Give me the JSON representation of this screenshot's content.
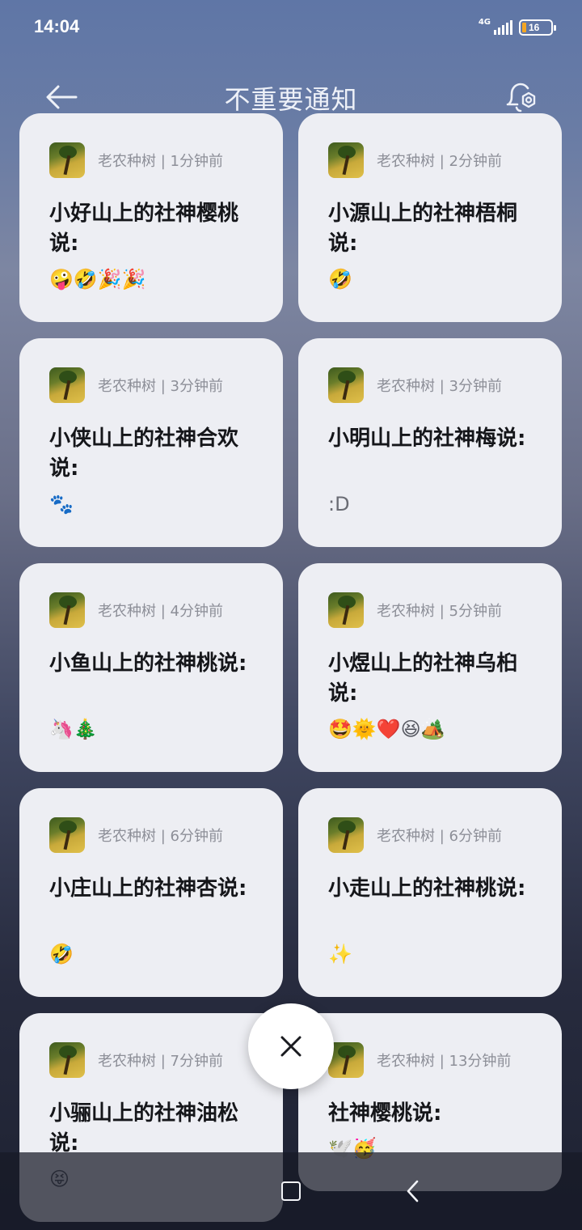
{
  "status_bar": {
    "time": "14:04",
    "network": "4G",
    "battery": "16"
  },
  "header": {
    "title": "不重要通知"
  },
  "notifications": [
    {
      "meta": "老农种树 | 1分钟前",
      "title": "小好山上的社神樱桃说:",
      "body": "🤪🤣🎉🎉"
    },
    {
      "meta": "老农种树 | 2分钟前",
      "title": "小源山上的社神梧桐说:",
      "body": "🤣"
    },
    {
      "meta": "老农种树 | 3分钟前",
      "title": "小侠山上的社神合欢说:",
      "body": "🐾"
    },
    {
      "meta": "老农种树 | 3分钟前",
      "title": "小明山上的社神梅说:",
      "body": ":D"
    },
    {
      "meta": "老农种树 | 4分钟前",
      "title": "小鱼山上的社神桃说:",
      "body": "🦄🎄"
    },
    {
      "meta": "老农种树 | 5分钟前",
      "title": "小煜山上的社神乌桕说:",
      "body": "🤩🌞❤️😆🏕️"
    },
    {
      "meta": "老农种树 | 6分钟前",
      "title": "小庄山上的社神杏说:",
      "body": "🤣"
    },
    {
      "meta": "老农种树 | 6分钟前",
      "title": "小走山上的社神桃说:",
      "body": "✨"
    },
    {
      "meta": "老农种树 | 7分钟前",
      "title": "小骊山上的社神油松说:",
      "body": "😝"
    },
    {
      "meta": "老农种树 | 13分钟前",
      "title": "社神樱桃说:",
      "body": "🕊️🥳"
    }
  ],
  "icons": {
    "back": "back-arrow-icon",
    "settings": "notification-settings-icon",
    "close": "close-icon",
    "home": "home-square-icon",
    "nav_back": "nav-back-icon"
  },
  "colors": {
    "card_bg": "#edeef3",
    "title_text": "#eef1f8",
    "meta_text": "#8d8f98"
  }
}
